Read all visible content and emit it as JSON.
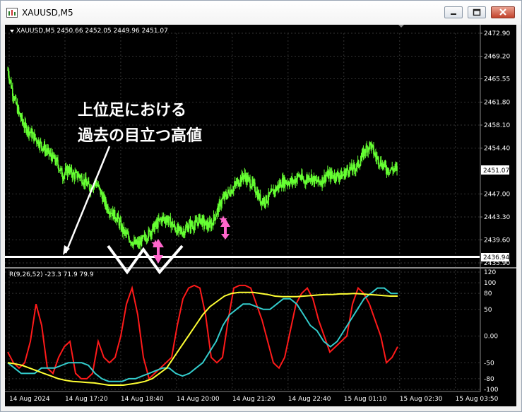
{
  "window": {
    "title": "XAUUSD,M5"
  },
  "header": {
    "info": "XAUUSD,M5  2450.66 2452.05 2449.96 2451.07"
  },
  "annotation": {
    "line1": "上位足における",
    "line2": "過去の目立つ高値"
  },
  "colors": {
    "background": "#000000",
    "candles": "#66ff33",
    "grid": "#333333",
    "red_line": "#ff1a1a",
    "cyan_line": "#33cccc",
    "yellow_line": "#ffff33",
    "arrow": "#ff66cc"
  },
  "chart_data": [
    {
      "type": "candlestick",
      "symbol": "XAUUSD",
      "timeframe": "M5",
      "ohlc_header": {
        "open": 2450.66,
        "high": 2452.05,
        "low": 2449.96,
        "close": 2451.07
      },
      "y_ticks": [
        "2472.90",
        "2469.20",
        "2465.55",
        "2461.80",
        "2458.10",
        "2454.40",
        "2447.00",
        "2443.30",
        "2439.60",
        "2435.90"
      ],
      "price_labels": {
        "current": "2451.07",
        "level": "2436.94"
      },
      "ylim": [
        2435.9,
        2472.9
      ],
      "grid": true,
      "close_path": [
        2467,
        2463,
        2460,
        2458,
        2457,
        2456,
        2455,
        2454,
        2453,
        2452,
        2450,
        2451,
        2450,
        2450,
        2449,
        2448,
        2449,
        2447,
        2445,
        2444,
        2443,
        2441,
        2440,
        2439,
        2439,
        2440,
        2441,
        2442,
        2443,
        2443,
        2442,
        2441,
        2441,
        2442,
        2442,
        2443,
        2442,
        2442,
        2444,
        2446,
        2447,
        2448,
        2449,
        2450,
        2449,
        2448,
        2446,
        2446,
        2447,
        2448,
        2449,
        2449,
        2449,
        2450,
        2449,
        2450,
        2449,
        2449,
        2450,
        2450,
        2450,
        2450,
        2451,
        2451,
        2452,
        2454,
        2455,
        2453,
        2452,
        2451,
        2451
      ]
    },
    {
      "type": "line",
      "indicator_label": "R(9,26,52) -23.3 71.9 79.9",
      "y_ticks": [
        "120",
        "100",
        "80",
        "50",
        "0.00",
        "-50",
        "-80",
        "-100"
      ],
      "ylim": [
        -100,
        120
      ],
      "x_ticks": [
        "14 Aug 2024",
        "14 Aug 17:20",
        "14 Aug 18:40",
        "14 Aug 20:00",
        "14 Aug 21:20",
        "14 Aug 22:40",
        "15 Aug 01:10",
        "15 Aug 02:30",
        "15 Aug 03:50"
      ],
      "series": [
        {
          "color": "#ff1a1a",
          "values": [
            -30,
            -50,
            -60,
            -50,
            -10,
            60,
            20,
            -60,
            -70,
            -40,
            -20,
            -10,
            -70,
            -80,
            -80,
            -70,
            -10,
            -40,
            -50,
            -40,
            0,
            60,
            90,
            40,
            -40,
            -80,
            -70,
            -60,
            -50,
            -40,
            20,
            70,
            90,
            95,
            90,
            40,
            -40,
            -50,
            -40,
            30,
            90,
            95,
            95,
            90,
            60,
            30,
            -10,
            -50,
            -60,
            -40,
            10,
            60,
            80,
            90,
            70,
            30,
            0,
            -30,
            -20,
            -10,
            0,
            60,
            90,
            80,
            60,
            30,
            0,
            -50,
            -40,
            -20
          ]
        },
        {
          "color": "#33cccc",
          "values": [
            -50,
            -60,
            -70,
            -70,
            -70,
            -60,
            -60,
            -60,
            -55,
            -50,
            -50,
            -50,
            -55,
            -70,
            -80,
            -85,
            -85,
            -85,
            -80,
            -80,
            -75,
            -70,
            -65,
            -60,
            -60,
            -70,
            -75,
            -70,
            -60,
            -50,
            -30,
            -10,
            20,
            40,
            50,
            60,
            60,
            55,
            50,
            50,
            60,
            70,
            70,
            60,
            40,
            20,
            10,
            -10,
            -20,
            -10,
            10,
            30,
            50,
            70,
            80,
            90,
            90,
            80,
            80
          ]
        },
        {
          "color": "#ffff33",
          "values": [
            -50,
            -52,
            -55,
            -60,
            -65,
            -70,
            -75,
            -80,
            -83,
            -85,
            -86,
            -87,
            -88,
            -90,
            -92,
            -92,
            -92,
            -90,
            -88,
            -85,
            -80,
            -70,
            -60,
            -40,
            -20,
            0,
            20,
            40,
            55,
            65,
            75,
            80,
            82,
            82,
            82,
            80,
            78,
            75,
            74,
            74,
            74,
            75,
            76,
            77,
            78,
            78,
            79,
            79,
            80,
            79,
            78,
            77,
            76,
            75,
            75
          ]
        }
      ]
    }
  ]
}
